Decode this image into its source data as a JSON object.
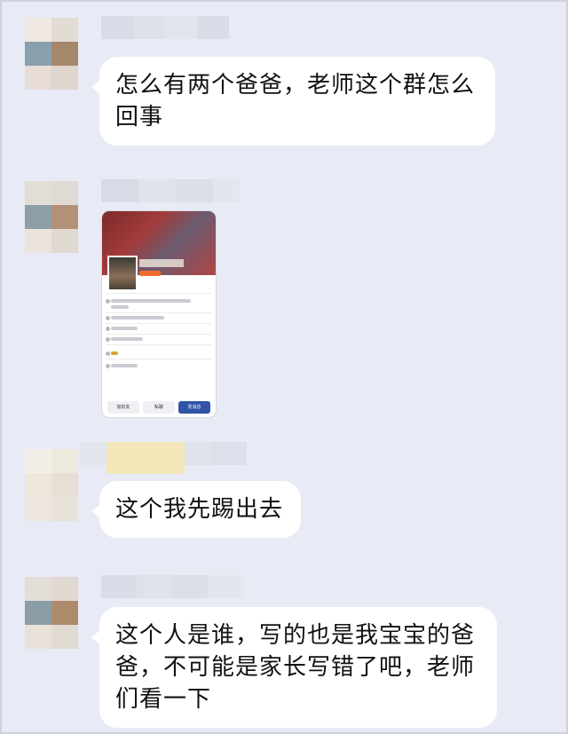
{
  "messages": [
    {
      "text": "怎么有两个爸爸，老师这个群怎么回事"
    },
    {
      "type": "image",
      "description_hidden": false,
      "buttons": [
        "加好友",
        "私聊",
        "发消息"
      ]
    },
    {
      "text": "这个我先踢出去"
    },
    {
      "text": "这个人是谁，写的也是我宝宝的爸爸，不可能是家长写错了吧，老师们看一下"
    }
  ],
  "colors": {
    "background": "#e8ebf5",
    "bubble": "#ffffff",
    "accent": "#2f54a8"
  }
}
